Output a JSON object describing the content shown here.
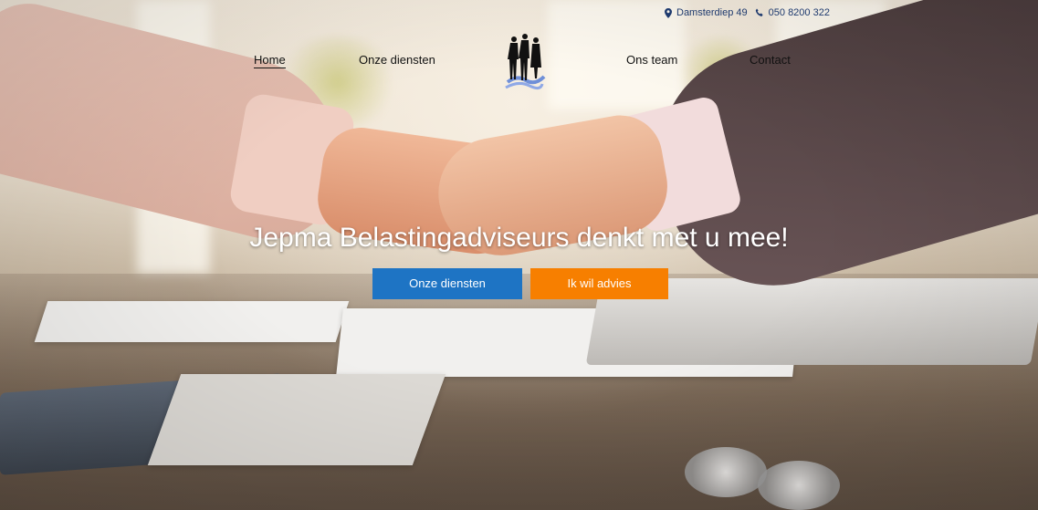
{
  "contact": {
    "address": "Damsterdiep 49",
    "phone": "050 8200 322",
    "address_icon": "map-marker-icon",
    "phone_icon": "phone-icon"
  },
  "nav": {
    "items": [
      {
        "label": "Home",
        "active": true
      },
      {
        "label": "Onze diensten",
        "active": false
      },
      {
        "label": "Ons team",
        "active": false
      },
      {
        "label": "Contact",
        "active": false
      }
    ]
  },
  "hero": {
    "headline": "Jepma Belastingadviseurs denkt met u mee!",
    "button_primary": "Onze diensten",
    "button_secondary": "Ik wil advies"
  },
  "colors": {
    "primary_button": "#1e74c4",
    "secondary_button": "#f77f00",
    "topbar_text": "#1e3a6e"
  }
}
